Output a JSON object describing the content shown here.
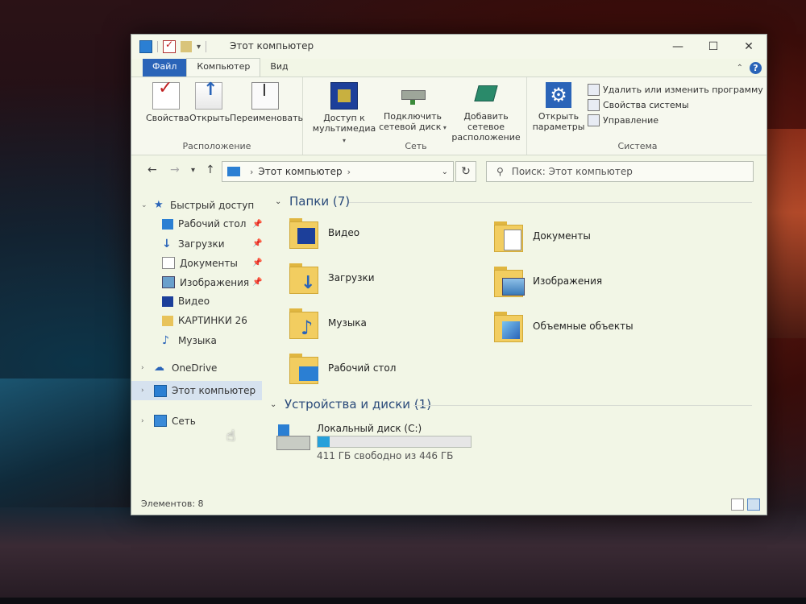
{
  "window": {
    "title": "Этот компьютер",
    "controls": {
      "minimize": "—",
      "maximize": "☐",
      "close": "✕"
    }
  },
  "tabs": {
    "file": "Файл",
    "computer": "Компьютер",
    "view": "Вид"
  },
  "ribbon": {
    "location": {
      "label": "Расположение",
      "properties": "Свойства",
      "open": "Открыть",
      "rename": "Переименовать"
    },
    "network": {
      "label": "Сеть",
      "media_line1": "Доступ к",
      "media_line2": "мультимедиа",
      "netdrive_line1": "Подключить",
      "netdrive_line2": "сетевой диск",
      "netloc_line1": "Добавить сетевое",
      "netloc_line2": "расположение"
    },
    "system": {
      "label": "Система",
      "open_params_line1": "Открыть",
      "open_params_line2": "параметры",
      "uninstall": "Удалить или изменить программу",
      "sys_props": "Свойства системы",
      "manage": "Управление"
    }
  },
  "nav": {
    "address_root": "Этот компьютер",
    "search_placeholder": "Поиск: Этот компьютер"
  },
  "sidebar": {
    "quick_access": "Быстрый доступ",
    "items": [
      {
        "label": "Рабочий стол",
        "pinned": true
      },
      {
        "label": "Загрузки",
        "pinned": true
      },
      {
        "label": "Документы",
        "pinned": true
      },
      {
        "label": "Изображения",
        "pinned": true
      },
      {
        "label": "Видео",
        "pinned": false
      },
      {
        "label": "КАРТИНКИ 26",
        "pinned": false
      },
      {
        "label": "Музыка",
        "pinned": false
      }
    ],
    "onedrive": "OneDrive",
    "this_pc": "Этот компьютер",
    "network": "Сеть"
  },
  "content": {
    "folders_header": "Папки (7)",
    "folders": [
      {
        "label": "Видео",
        "icon": "video-folder-icon"
      },
      {
        "label": "Документы",
        "icon": "documents-folder-icon"
      },
      {
        "label": "Загрузки",
        "icon": "downloads-folder-icon"
      },
      {
        "label": "Изображения",
        "icon": "pictures-folder-icon"
      },
      {
        "label": "Музыка",
        "icon": "music-folder-icon"
      },
      {
        "label": "Объемные объекты",
        "icon": "3d-objects-folder-icon"
      },
      {
        "label": "Рабочий стол",
        "icon": "desktop-folder-icon"
      }
    ],
    "devices_header": "Устройства и диски (1)",
    "drive": {
      "name": "Локальный диск (C:)",
      "free_text": "411 ГБ свободно из 446 ГБ",
      "used_fraction": 0.08,
      "bar_color": "#26a0da"
    }
  },
  "status": {
    "items": "Элементов: 8"
  }
}
